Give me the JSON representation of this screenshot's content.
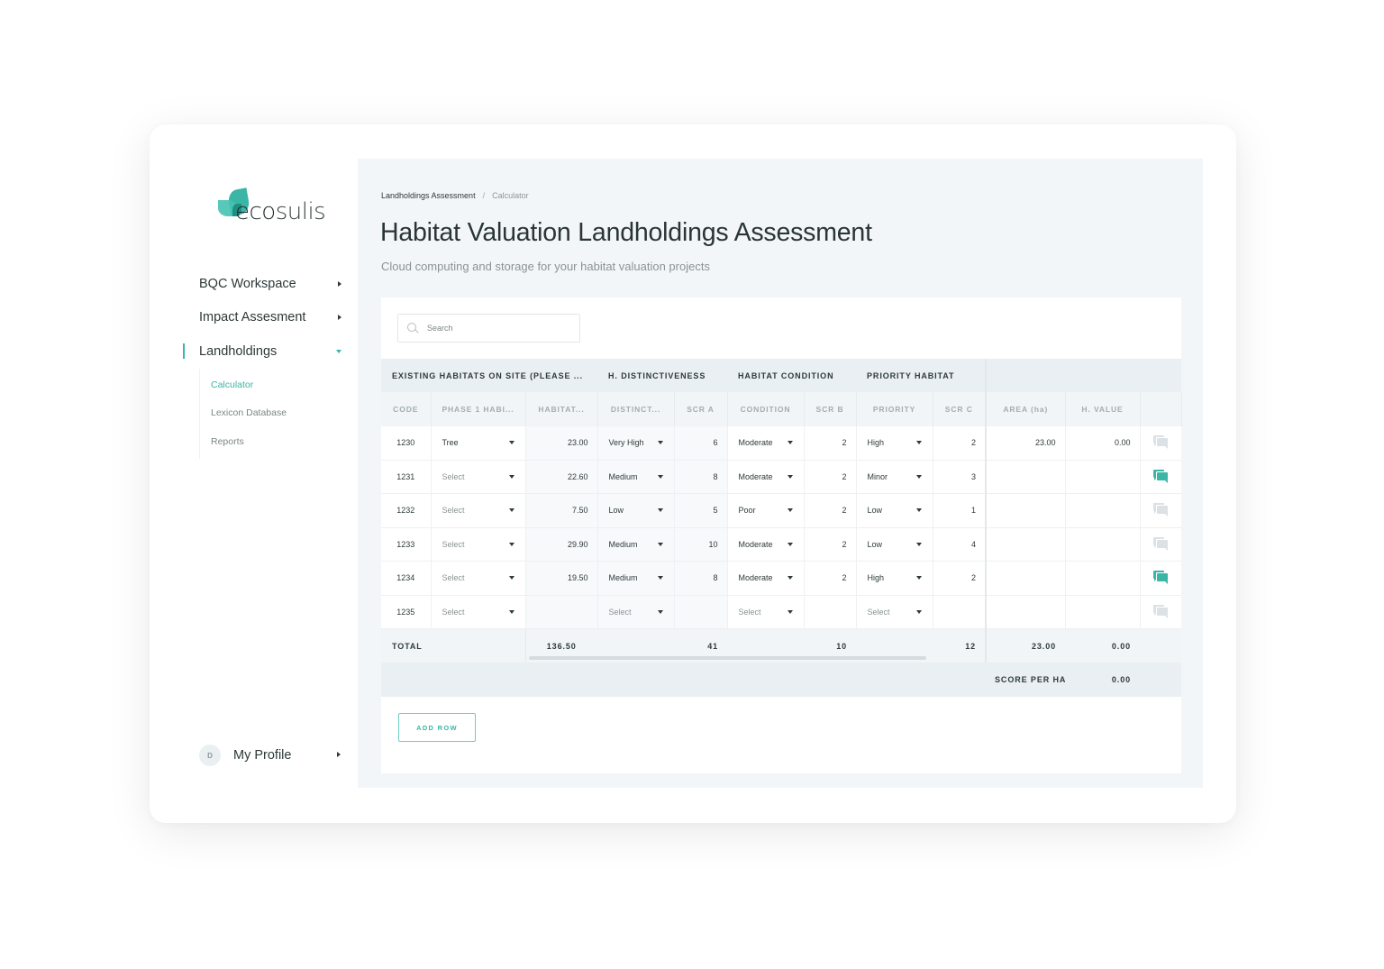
{
  "brand": {
    "name_part1": "eco",
    "name_part2": "sulis",
    "accent": "#3bb5a6"
  },
  "sidebar": {
    "items": [
      {
        "label": "BQC Workspace",
        "icon": "caret-right-icon"
      },
      {
        "label": "Impact Assesment",
        "icon": "caret-right-icon"
      },
      {
        "label": "Landholdings",
        "icon": "caret-down-icon",
        "active": true
      }
    ],
    "subitems": [
      {
        "label": "Calculator",
        "active": true
      },
      {
        "label": "Lexicon Database"
      },
      {
        "label": "Reports"
      }
    ],
    "profile": {
      "initial": "D",
      "label": "My Profile"
    }
  },
  "breadcrumb": {
    "parent": "Landholdings Assessment",
    "separator": "/",
    "current": "Calculator"
  },
  "page": {
    "title": "Habitat Valuation Landholdings Assessment",
    "subtitle": "Cloud computing and storage for your habitat valuation projects"
  },
  "search": {
    "placeholder": "Search",
    "value": ""
  },
  "table": {
    "groups": [
      "EXISTING HABITATS ON SITE (PLEASE ...",
      "H. DISTINCTIVENESS",
      "HABITAT CONDITION",
      "PRIORITY HABITAT",
      ""
    ],
    "columns": [
      "CODE",
      "PHASE 1 HABI...",
      "HABITAT...",
      "DISTINCT...",
      "SCR A",
      "CONDITION",
      "SCR B",
      "PRIORITY",
      "SCR C",
      "AREA (ha)",
      "H. VALUE",
      ""
    ],
    "rows": [
      {
        "code": "1230",
        "phase": "Tree",
        "phase_is_placeholder": false,
        "habitat": "23.00",
        "distinct": "Very High",
        "scr_a": "6",
        "condition": "Moderate",
        "scr_b": "2",
        "priority": "High",
        "scr_c": "2",
        "area": "23.00",
        "hvalue": "0.00",
        "comment_active": false
      },
      {
        "code": "1231",
        "phase": "Select",
        "phase_is_placeholder": true,
        "habitat": "22.60",
        "distinct": "Medium",
        "scr_a": "8",
        "condition": "Moderate",
        "scr_b": "2",
        "priority": "Minor",
        "scr_c": "3",
        "area": "",
        "hvalue": "",
        "comment_active": true
      },
      {
        "code": "1232",
        "phase": "Select",
        "phase_is_placeholder": true,
        "habitat": "7.50",
        "distinct": "Low",
        "scr_a": "5",
        "condition": "Poor",
        "scr_b": "2",
        "priority": "Low",
        "scr_c": "1",
        "area": "",
        "hvalue": "",
        "comment_active": false
      },
      {
        "code": "1233",
        "phase": "Select",
        "phase_is_placeholder": true,
        "habitat": "29.90",
        "distinct": "Medium",
        "scr_a": "10",
        "condition": "Moderate",
        "scr_b": "2",
        "priority": "Low",
        "scr_c": "4",
        "area": "",
        "hvalue": "",
        "comment_active": false
      },
      {
        "code": "1234",
        "phase": "Select",
        "phase_is_placeholder": true,
        "habitat": "19.50",
        "distinct": "Medium",
        "scr_a": "8",
        "condition": "Moderate",
        "scr_b": "2",
        "priority": "High",
        "scr_c": "2",
        "area": "",
        "hvalue": "",
        "comment_active": true
      },
      {
        "code": "1235",
        "phase": "Select",
        "phase_is_placeholder": true,
        "habitat": "",
        "distinct": "Select",
        "distinct_is_placeholder": true,
        "scr_a": "",
        "condition": "Select",
        "condition_is_placeholder": true,
        "scr_b": "",
        "priority": "Select",
        "priority_is_placeholder": true,
        "scr_c": "",
        "area": "",
        "hvalue": "",
        "comment_active": false
      }
    ],
    "total": {
      "label": "TOTAL",
      "habitat": "136.50",
      "scr_a": "41",
      "scr_b": "10",
      "scr_c": "12",
      "area": "23.00",
      "hvalue": "0.00"
    },
    "score_per_ha": {
      "label": "SCORE PER HA",
      "value": "0.00"
    }
  },
  "actions": {
    "add_row": "ADD ROW"
  }
}
